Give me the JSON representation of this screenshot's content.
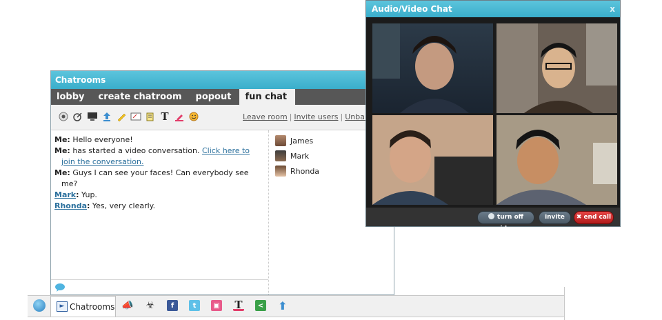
{
  "chat": {
    "title": "Chatrooms",
    "tabs": [
      {
        "label": "lobby"
      },
      {
        "label": "create chatroom"
      },
      {
        "label": "popout"
      },
      {
        "label": "fun chat"
      }
    ],
    "toolbar_links": {
      "leave": "Leave room",
      "invite": "Invite users",
      "unban": "Unban"
    },
    "messages": [
      {
        "from": "Me:",
        "text": "Hello everyone!"
      },
      {
        "from": "Me:",
        "text": "has started a video conversation.",
        "link": "Click here to join the conversation."
      },
      {
        "from": "Me:",
        "text": "Guys I can see your faces! Can everybody see me?"
      },
      {
        "from": "Mark",
        "text": "Yup."
      },
      {
        "from": "Rhonda",
        "text": "Yes, very clearly."
      }
    ],
    "users": [
      "James",
      "Mark",
      "Rhonda"
    ]
  },
  "video": {
    "title": "Audio/Video Chat",
    "close": "x",
    "buttons": {
      "video": "turn off video",
      "invite": "invite",
      "end": "end call"
    }
  },
  "taskbar": {
    "tab_label": "Chatrooms"
  },
  "colors": {
    "title_bar": "#3aaecb",
    "tab_bar": "#575757",
    "end_call": "#c42a2a",
    "link": "#2a6f9c"
  }
}
